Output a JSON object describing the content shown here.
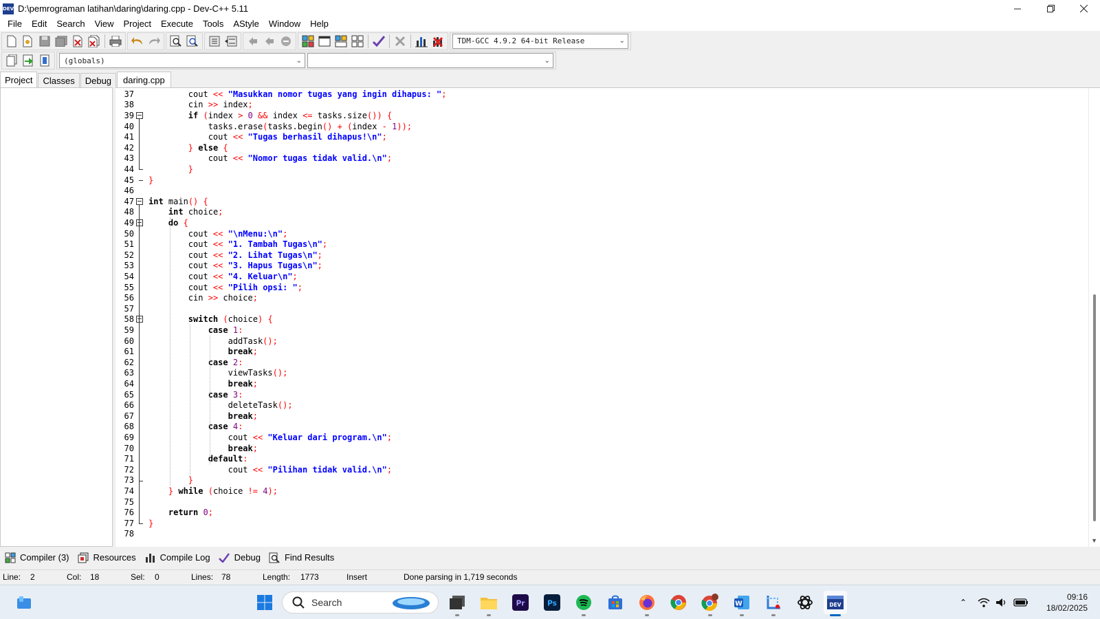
{
  "window": {
    "title": "D:\\pemrograman latihan\\daring\\daring.cpp - Dev-C++ 5.11",
    "app_icon_text": "DEV",
    "controls": [
      "minimize",
      "restore",
      "close"
    ]
  },
  "menu": [
    "File",
    "Edit",
    "Search",
    "View",
    "Project",
    "Execute",
    "Tools",
    "AStyle",
    "Window",
    "Help"
  ],
  "toolbar": {
    "compiler_select": "TDM-GCC 4.9.2 64-bit Release",
    "scope_select": "(globals)",
    "member_select": ""
  },
  "left_panel": {
    "tabs": [
      "Project",
      "Classes",
      "Debug"
    ],
    "active_tab": "Project"
  },
  "editor": {
    "file_tab": "daring.cpp",
    "lines": [
      {
        "n": "37",
        "text": "        cout << \"Masukkan nomor tugas yang ingin dihapus: \";"
      },
      {
        "n": "38",
        "text": "        cin >> index;"
      },
      {
        "n": "39",
        "text": "        if (index > 0 && index <= tasks.size()) {"
      },
      {
        "n": "40",
        "text": "            tasks.erase(tasks.begin() + (index - 1));"
      },
      {
        "n": "41",
        "text": "            cout << \"Tugas berhasil dihapus!\\n\";"
      },
      {
        "n": "42",
        "text": "        } else {"
      },
      {
        "n": "43",
        "text": "            cout << \"Nomor tugas tidak valid.\\n\";"
      },
      {
        "n": "44",
        "text": "        }"
      },
      {
        "n": "45",
        "text": "}"
      },
      {
        "n": "46",
        "text": ""
      },
      {
        "n": "47",
        "text": "int main() {"
      },
      {
        "n": "48",
        "text": "    int choice;"
      },
      {
        "n": "49",
        "text": "    do {"
      },
      {
        "n": "50",
        "text": "        cout << \"\\nMenu:\\n\";"
      },
      {
        "n": "51",
        "text": "        cout << \"1. Tambah Tugas\\n\";"
      },
      {
        "n": "52",
        "text": "        cout << \"2. Lihat Tugas\\n\";"
      },
      {
        "n": "53",
        "text": "        cout << \"3. Hapus Tugas\\n\";"
      },
      {
        "n": "54",
        "text": "        cout << \"4. Keluar\\n\";"
      },
      {
        "n": "55",
        "text": "        cout << \"Pilih opsi: \";"
      },
      {
        "n": "56",
        "text": "        cin >> choice;"
      },
      {
        "n": "57",
        "text": ""
      },
      {
        "n": "58",
        "text": "        switch (choice) {"
      },
      {
        "n": "59",
        "text": "            case 1:"
      },
      {
        "n": "60",
        "text": "                addTask();"
      },
      {
        "n": "61",
        "text": "                break;"
      },
      {
        "n": "62",
        "text": "            case 2:"
      },
      {
        "n": "63",
        "text": "                viewTasks();"
      },
      {
        "n": "64",
        "text": "                break;"
      },
      {
        "n": "65",
        "text": "            case 3:"
      },
      {
        "n": "66",
        "text": "                deleteTask();"
      },
      {
        "n": "67",
        "text": "                break;"
      },
      {
        "n": "68",
        "text": "            case 4:"
      },
      {
        "n": "69",
        "text": "                cout << \"Keluar dari program.\\n\";"
      },
      {
        "n": "70",
        "text": "                break;"
      },
      {
        "n": "71",
        "text": "            default:"
      },
      {
        "n": "72",
        "text": "                cout << \"Pilihan tidak valid.\\n\";"
      },
      {
        "n": "73",
        "text": "        }"
      },
      {
        "n": "74",
        "text": "    } while (choice != 4);"
      },
      {
        "n": "75",
        "text": ""
      },
      {
        "n": "76",
        "text": "    return 0;"
      },
      {
        "n": "77",
        "text": "}"
      },
      {
        "n": "78",
        "text": ""
      }
    ]
  },
  "bottom_tabs": [
    {
      "label": "Compiler (3)",
      "icon": "compiler-grid-icon"
    },
    {
      "label": "Resources",
      "icon": "resources-icon"
    },
    {
      "label": "Compile Log",
      "icon": "bar-chart-icon"
    },
    {
      "label": "Debug",
      "icon": "check-mark-icon"
    },
    {
      "label": "Find Results",
      "icon": "find-results-icon"
    }
  ],
  "status": {
    "line_label": "Line:",
    "line_value": "2",
    "col_label": "Col:",
    "col_value": "18",
    "sel_label": "Sel:",
    "sel_value": "0",
    "lines_label": "Lines:",
    "lines_value": "78",
    "length_label": "Length:",
    "length_value": "1773",
    "mode": "Insert",
    "message": "Done parsing in 1,719 seconds"
  },
  "taskbar": {
    "search_placeholder": "Search",
    "apps": [
      "widgets",
      "start",
      "file-explorer-window",
      "file-explorer",
      "premiere-pro",
      "photoshop",
      "spotify",
      "microsoft-store",
      "firefox",
      "chrome",
      "chrome-profile",
      "word",
      "snipping-tool",
      "chatgpt",
      "dev-cpp"
    ],
    "time": "09:16",
    "date": "18/02/2025"
  },
  "colors": {
    "keyword": "#000000",
    "string": "#0000ff",
    "operator": "#ff0000",
    "number": "#800080",
    "taskbar_bg": "#e8eef5",
    "accent": "#0067c0"
  }
}
